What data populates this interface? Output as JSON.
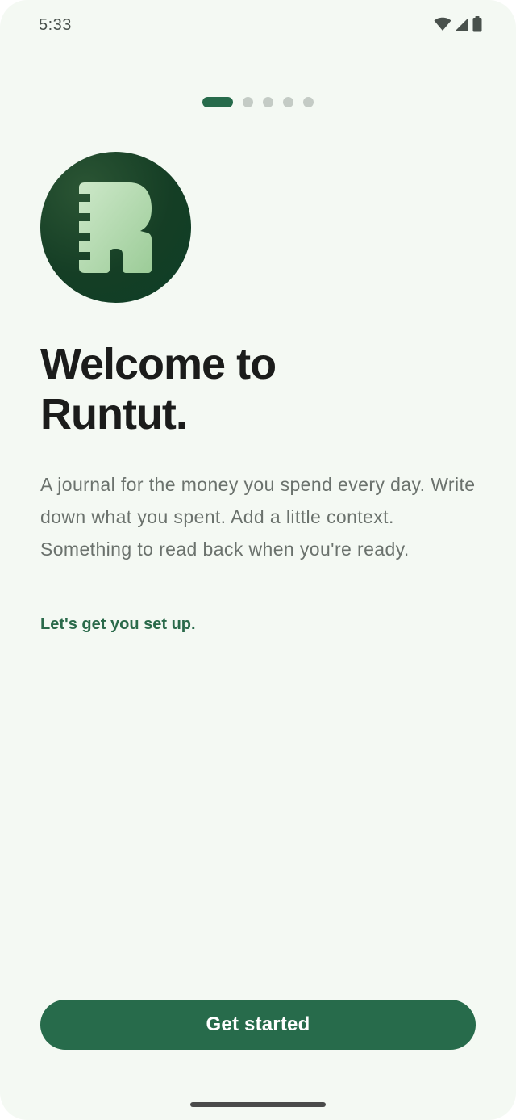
{
  "status_bar": {
    "time": "5:33",
    "icons": [
      "wifi-icon",
      "cellular-signal-icon",
      "battery-icon"
    ]
  },
  "pager": {
    "total_pages": 5,
    "current_page": 1
  },
  "logo": {
    "icon": "runtut-logo-icon"
  },
  "welcome": {
    "title_line1": "Welcome to",
    "title_line2": "Runtut.",
    "description": "A journal for the money you spend every day. Write down what you spent. Add a little context. Something to read back when you're ready.",
    "setup_note": "Let's get you set up."
  },
  "actions": {
    "get_started_label": "Get started"
  },
  "colors": {
    "background": "#f4f9f3",
    "accent": "#276b4b",
    "logo_dark": "#153e25",
    "logo_light": "#b8dcb6",
    "title_text": "#1b1c1b",
    "body_text": "#6b726d",
    "inactive_dot": "#c4cbc5"
  }
}
